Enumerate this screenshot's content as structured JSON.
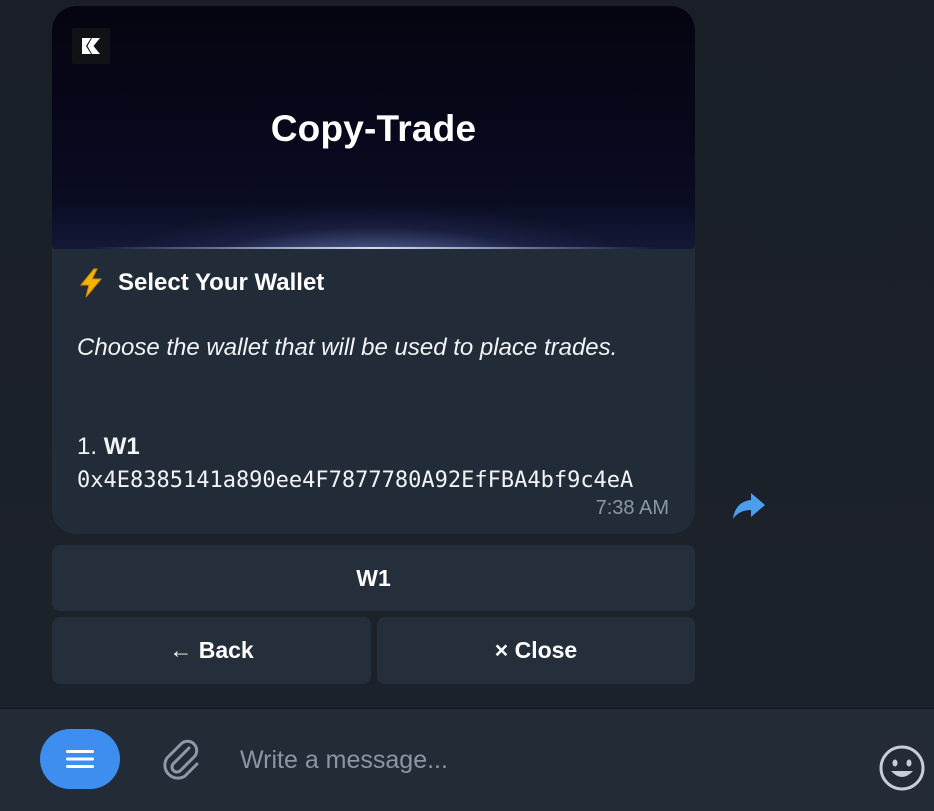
{
  "message": {
    "banner": {
      "title": "Copy-Trade",
      "logo_icon": "k-logo-icon"
    },
    "heading": {
      "icon": "lightning-bolt-icon",
      "text": "Select Your Wallet"
    },
    "body_text": "Choose the wallet that will be used to place trades.",
    "wallet": {
      "index": "1.",
      "name": "W1",
      "address": "0x4E8385141a890ee4F7877780A92EfFBA4bf9c4eA"
    },
    "timestamp": "7:38 AM"
  },
  "keyboard": {
    "wallet_button": "W1",
    "back_button": "← Back",
    "close_button": "× Close"
  },
  "composer": {
    "placeholder": "Write a message...",
    "menu_icon": "menu-icon",
    "attach_icon": "paperclip-icon",
    "emoji_icon": "emoji-icon"
  },
  "colors": {
    "accent": "#3e8ef0",
    "bubble": "#222c39",
    "keyboard_button": "#252f3c",
    "composer_bg": "#232b37",
    "background": "#1b2028"
  }
}
